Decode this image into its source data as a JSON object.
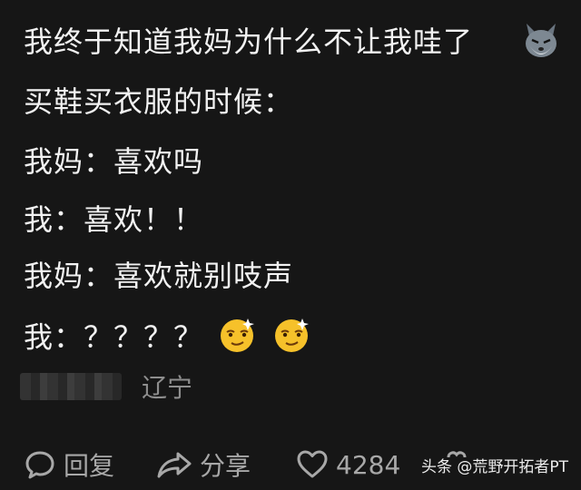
{
  "comment": {
    "lines": [
      "我终于知道我妈为什么不让我哇了",
      "买鞋买衣服的时候：",
      "我妈：喜欢吗",
      "我：喜欢！！",
      "我妈：喜欢就别吱声",
      "我：？？？？"
    ],
    "trailing_icons": [
      "wolf-emoji-icon",
      "smug-face-emoji-icon",
      "smug-face-emoji-icon"
    ]
  },
  "author": {
    "name_blurred": true,
    "location": "辽宁"
  },
  "actions": {
    "reply_label": "回复",
    "share_label": "分享",
    "like_count": "4284"
  },
  "watermark": "头条 @荒野开拓者PT"
}
